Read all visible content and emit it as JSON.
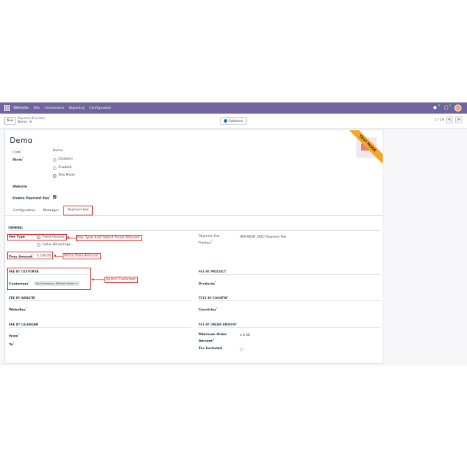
{
  "navbar": {
    "brand": "Website",
    "menus": [
      "Site",
      "eCommerce",
      "Reporting",
      "Configuration"
    ],
    "chat_badge": "6",
    "activity_badge": "5"
  },
  "control_panel": {
    "new_label": "New",
    "breadcrumb_parent": "Payment Providers",
    "breadcrumb_current": "Demo",
    "published_label": "Published",
    "pager": "1 / 16",
    "prev": "<",
    "next": ">"
  },
  "record": {
    "title": "Demo",
    "ribbon": "TEST MODE",
    "code_label": "Code",
    "code_value": "Demo",
    "state_label": "State",
    "state_options": [
      "Disabled",
      "Enabled",
      "Test Mode"
    ],
    "state_selected": "Test Mode",
    "website_label": "Website",
    "enable_fee_label": "Enable Payment Fee",
    "enable_fee_checked": true
  },
  "tabs": [
    "Configuration",
    "Messages",
    "Payment Fee"
  ],
  "active_tab": "Payment Fee",
  "payment_fee": {
    "general_header": "GENERAL",
    "fee_type_label": "Fee Type",
    "fee_type_options": [
      "Fixed Amount",
      "Order Percentage"
    ],
    "fee_type_selected": "Fixed Amount",
    "fees_amount_label": "Fees Amount",
    "fees_amount_value": "$ 100.00",
    "fee_product_label_1": "Payment Fee",
    "fee_product_label_2": "Product",
    "fee_product_value": "[PAYMENT_FEE] Payment Fee",
    "by_customer_header": "FEE BY CUSTOMER",
    "customers_label": "Customers",
    "customer_tag": "YourCompany, Mitchell Admin",
    "by_product_header": "FEE BY PRODUCT",
    "products_label": "Products",
    "by_website_header": "FEE BY WEBSITE",
    "websites_label": "Websites",
    "by_country_header": "FEES BY COUNTRY",
    "countries_label": "Countries",
    "by_calendar_header": "FEE BY CALENDAR",
    "from_label": "From",
    "to_label": "To",
    "by_order_amount_header": "FEE BY ORDER AMOUNT",
    "min_order_label_1": "Minimum Order",
    "min_order_label_2": "Amount",
    "min_order_value": "$ 0.00",
    "tax_excluded_label": "Tax Excluded"
  },
  "annotations": {
    "fee_type": "Fee Type And Select Fixed Amount.",
    "fees_amount": "Write Fees Amount.",
    "customer": "Select Customer."
  },
  "colors": {
    "brand": "#71639e",
    "annotation": "#e02424",
    "ribbon": "#f5a623"
  }
}
